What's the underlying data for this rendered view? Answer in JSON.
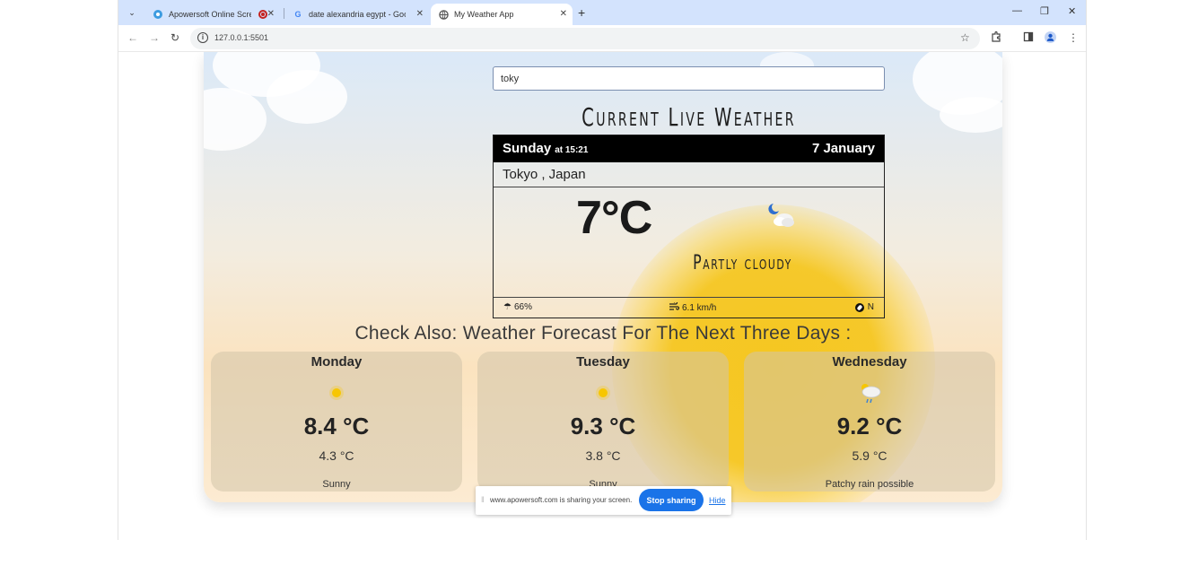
{
  "browser": {
    "tabs": [
      {
        "title": "Apowersoft Online Screen",
        "favicon": "apowersoft-icon",
        "recording": true
      },
      {
        "title": "date alexandria egypt - Google",
        "favicon": "google-icon",
        "recording": false
      },
      {
        "title": "My Weather App",
        "favicon": "globe-icon",
        "recording": false
      }
    ],
    "url": "127.0.0.1:5501"
  },
  "search": {
    "value": "toky"
  },
  "app": {
    "title": "Current Live Weather"
  },
  "current": {
    "day": "Sunday",
    "time": "at 15:21",
    "date": "7 January",
    "location": "Tokyo , Japan",
    "temperature": "7°C",
    "condition": "Partly cloudy",
    "humidity": "66%",
    "wind": "6.1 km/h",
    "direction": "N"
  },
  "forecast": {
    "heading": "Check Also: Weather Forecast For The Next Three Days :",
    "days": [
      {
        "day": "Monday",
        "max": "8.4 °C",
        "min": "4.3 °C",
        "condition": "Sunny",
        "icon": "sun-icon"
      },
      {
        "day": "Tuesday",
        "max": "9.3 °C",
        "min": "3.8 °C",
        "condition": "Sunny",
        "icon": "sun-icon"
      },
      {
        "day": "Wednesday",
        "max": "9.2 °C",
        "min": "5.9 °C",
        "condition": "Patchy rain possible",
        "icon": "rain-cloud-icon"
      }
    ]
  },
  "share_bar": {
    "text": "www.apowersoft.com is sharing your screen.",
    "stop_label": "Stop sharing",
    "hide_label": "Hide"
  },
  "colors": {
    "accent": "#1a73e8",
    "sun": "#f5c518",
    "header_black": "#000000"
  }
}
